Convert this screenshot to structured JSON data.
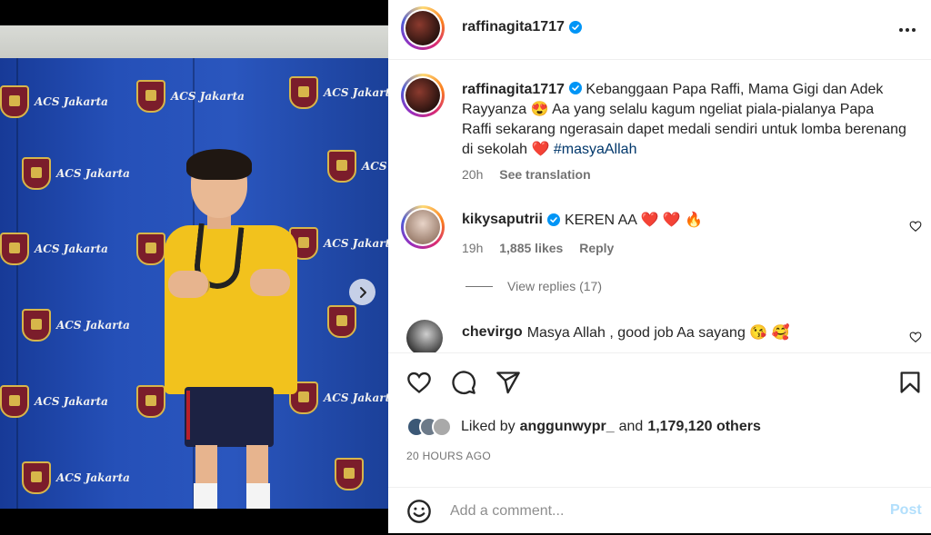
{
  "post": {
    "author": "raffinagita1717",
    "caption_text": "Kebanggaan Papa Raffi, Mama Gigi dan Adek Rayyanza 😍 Aa yang selalu kagum ngeliat piala-pialanya Papa Raffi sekarang ngerasain dapet medali sendiri untuk lomba berenang di sekolah ❤️ ",
    "caption_hashtag": "#masyaAllah",
    "caption_time": "20h",
    "see_translation": "See translation"
  },
  "photo": {
    "backdrop_text": "ACS Jakarta"
  },
  "comments": [
    {
      "username": "kikysaputrii",
      "text": "KEREN AA ❤️ ❤️ 🔥",
      "time": "19h",
      "likes": "1,885 likes",
      "reply": "Reply",
      "view_replies": "View replies (17)"
    },
    {
      "username": "chevirgo",
      "text": "Masya Allah , good job Aa sayang 😘 🥰"
    }
  ],
  "likes": {
    "prefix": "Liked by",
    "user": "anggunwypr_",
    "and": "and",
    "count": "1,179,120 others"
  },
  "timestamp": "20 HOURS AGO",
  "comment_box": {
    "placeholder": "Add a comment...",
    "post_label": "Post"
  },
  "colors": {
    "verified": "#0095f6",
    "post_disabled": "#b2dffc",
    "heart_red": "#ed4956"
  },
  "icons": [
    "more-icon",
    "heart-icon",
    "comment-icon",
    "share-icon",
    "bookmark-icon",
    "emoji-icon",
    "verified-icon",
    "chevron-right-icon"
  ]
}
